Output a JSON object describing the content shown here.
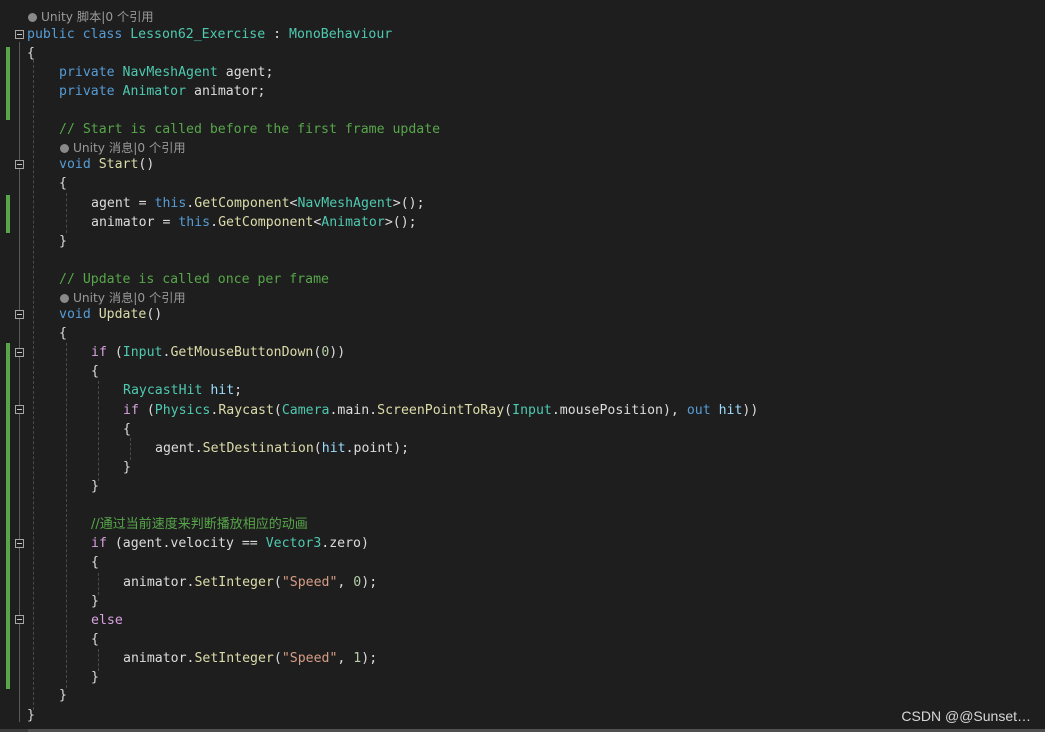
{
  "editor": {
    "lens_class": "Unity 脚本|0 个引用",
    "lens_start": "Unity 消息|0 个引用",
    "lens_update": "Unity 消息|0 个引用"
  },
  "code": {
    "l_class_kw": "public class ",
    "l_class_name": "Lesson62_Exercise",
    "l_class_colon": " : ",
    "l_class_base": "MonoBehaviour",
    "brace_open": "{",
    "brace_close": "}",
    "f1_kw": "private ",
    "f1_type": "NavMeshAgent",
    "f1_rest": " agent;",
    "f2_kw": "private ",
    "f2_type": "Animator",
    "f2_rest": " animator;",
    "c_start": "// Start is called before the first frame update",
    "start_kw": "void ",
    "start_fn": "Start",
    "start_paren": "()",
    "a1_pre": "agent = ",
    "a1_this": "this",
    "a1_dot": ".",
    "a1_fn": "GetComponent",
    "a1_lt": "<",
    "a1_type": "NavMeshAgent",
    "a1_end": ">();",
    "a2_pre": "animator = ",
    "a2_this": "this",
    "a2_dot": ".",
    "a2_fn": "GetComponent",
    "a2_lt": "<",
    "a2_type": "Animator",
    "a2_end": ">();",
    "c_update": "// Update is called once per frame",
    "update_kw": "void ",
    "update_fn": "Update",
    "update_paren": "()",
    "if1_kw": "if",
    "if1_sp": " (",
    "if1_type": "Input",
    "if1_dot": ".",
    "if1_fn": "GetMouseButtonDown",
    "if1_op": "(",
    "if1_num": "0",
    "if1_end": "))",
    "rh_type": "RaycastHit",
    "rh_var": " hit",
    "rh_end": ";",
    "if2_kw": "if",
    "if2_sp": " (",
    "if2_t1": "Physics",
    "if2_d1": ".",
    "if2_f1": "Raycast",
    "if2_p1": "(",
    "if2_t2": "Camera",
    "if2_d2": ".main.",
    "if2_f2": "ScreenPointToRay",
    "if2_p2": "(",
    "if2_t3": "Input",
    "if2_d3": ".mousePosition), ",
    "if2_out": "out",
    "if2_sp2": " ",
    "if2_hit": "hit",
    "if2_end": "))",
    "sd_pre": "agent.",
    "sd_fn": "SetDestination",
    "sd_p": "(",
    "sd_hit": "hit",
    "sd_end": ".point);",
    "c_cn": "//通过当前速度来判断播放相应的动画",
    "if3_kw": "if",
    "if3_mid": " (agent.velocity == ",
    "if3_type": "Vector3",
    "if3_end": ".zero)",
    "si1_pre": "animator.",
    "si1_fn": "SetInteger",
    "si1_p": "(",
    "si1_str": "\"Speed\"",
    "si1_c": ", ",
    "si1_num": "0",
    "si1_end": ");",
    "else_kw": "else",
    "si2_pre": "animator.",
    "si2_fn": "SetInteger",
    "si2_p": "(",
    "si2_str": "\"Speed\"",
    "si2_c": ", ",
    "si2_num": "1",
    "si2_end": ");"
  },
  "watermark": "CSDN @@Sunset…",
  "colors": {
    "background": "#1e1e1e",
    "keyword": "#569cd6",
    "type": "#4ec9b0",
    "method": "#dcdcaa",
    "comment": "#57a64a",
    "string": "#d69d85",
    "number": "#b5cea8",
    "control": "#d8a0df",
    "change_marker": "#57a64a"
  }
}
